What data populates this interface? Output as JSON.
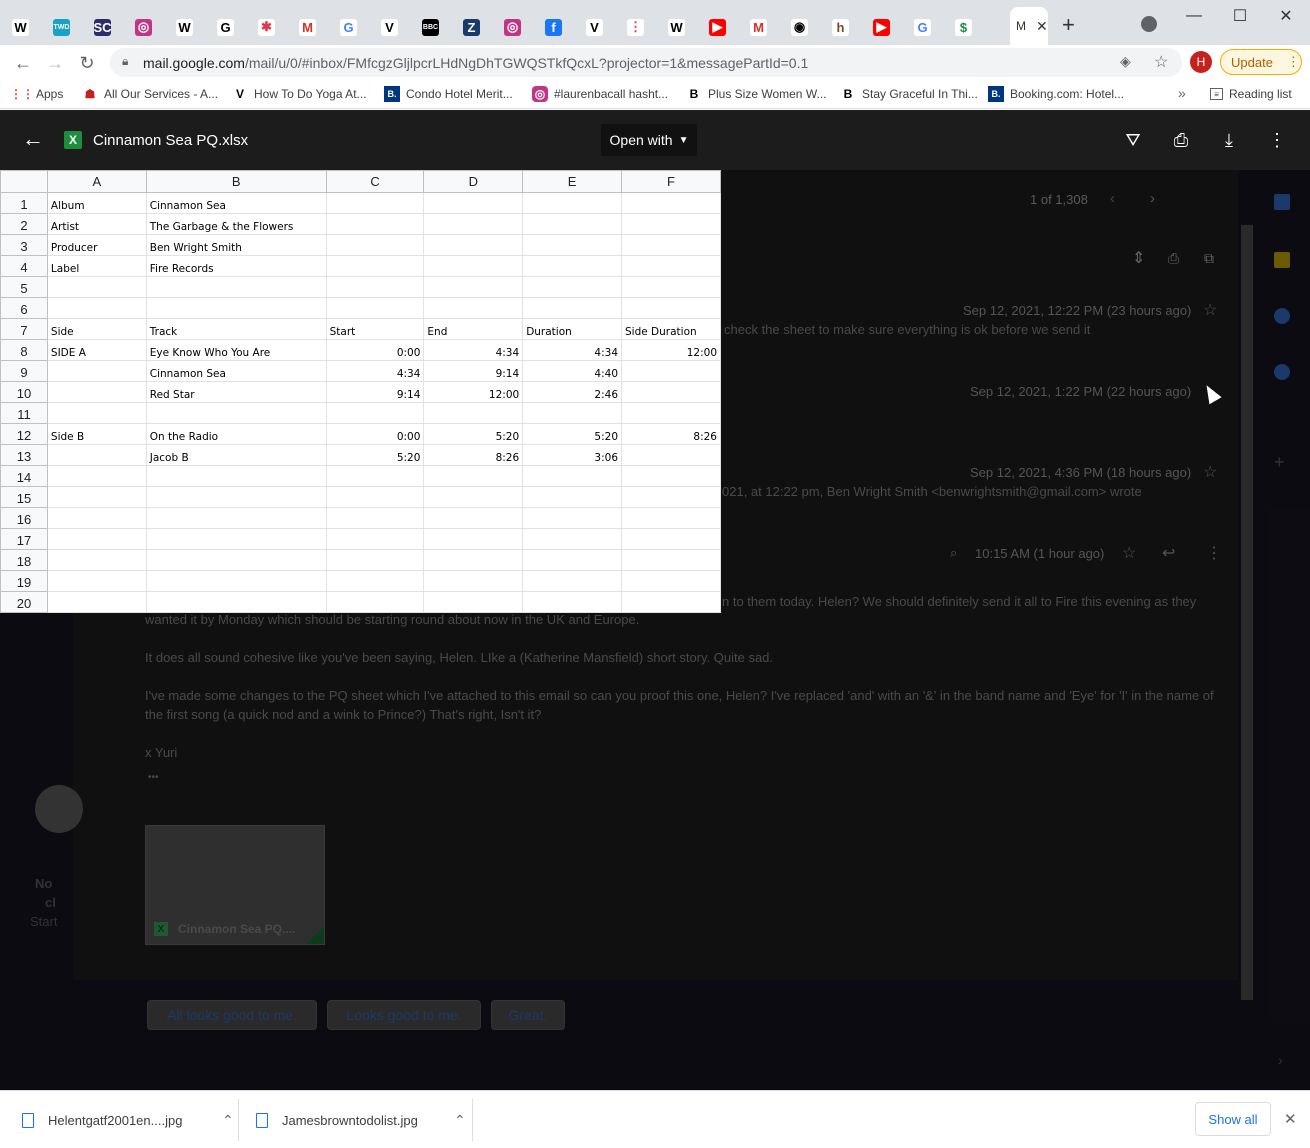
{
  "browser": {
    "tabs": [
      {
        "icon": "wikipedia-icon",
        "glyph": "W",
        "color": "#ffffff",
        "fg": "#000000"
      },
      {
        "icon": "twd-icon",
        "glyph": "TWD",
        "color": "#17a2c8",
        "fg": "#ffffff"
      },
      {
        "icon": "sc-icon",
        "glyph": "SC",
        "color": "#2c2c6c",
        "fg": "#ffffff"
      },
      {
        "icon": "instagram-icon",
        "glyph": "◎",
        "color": "#c13584",
        "fg": "#ffffff"
      },
      {
        "icon": "wikipedia-icon",
        "glyph": "W",
        "color": "#ffffff",
        "fg": "#000000"
      },
      {
        "icon": "genius-icon",
        "glyph": "G",
        "color": "#ffffff",
        "fg": "#000000"
      },
      {
        "icon": "asterisk-icon",
        "glyph": "✱",
        "color": "#ffffff",
        "fg": "#e23744"
      },
      {
        "icon": "gmail-icon",
        "glyph": "M",
        "color": "#ffffff",
        "fg": "#d93025"
      },
      {
        "icon": "google-icon",
        "glyph": "G",
        "color": "#ffffff",
        "fg": "#4285f4"
      },
      {
        "icon": "vogue-icon",
        "glyph": "V",
        "color": "#ffffff",
        "fg": "#000000"
      },
      {
        "icon": "bbc-icon",
        "glyph": "BBC",
        "color": "#000000",
        "fg": "#ffffff"
      },
      {
        "icon": "z-icon",
        "glyph": "Z",
        "color": "#1a3a6a",
        "fg": "#ffffff"
      },
      {
        "icon": "instagram-icon",
        "glyph": "◎",
        "color": "#c13584",
        "fg": "#ffffff"
      },
      {
        "icon": "facebook-icon",
        "glyph": "f",
        "color": "#1877f2",
        "fg": "#ffffff"
      },
      {
        "icon": "vogue-icon",
        "glyph": "V",
        "color": "#ffffff",
        "fg": "#000000"
      },
      {
        "icon": "dots-icon",
        "glyph": "⋮",
        "color": "#ffffff",
        "fg": "#e23744"
      },
      {
        "icon": "wikipedia-icon",
        "glyph": "W",
        "color": "#ffffff",
        "fg": "#000000"
      },
      {
        "icon": "youtube-icon",
        "glyph": "▶",
        "color": "#ff0000",
        "fg": "#ffffff"
      },
      {
        "icon": "gmail-icon",
        "glyph": "M",
        "color": "#ffffff",
        "fg": "#d93025"
      },
      {
        "icon": "abc-icon",
        "glyph": "◉",
        "color": "#ffffff",
        "fg": "#000000"
      },
      {
        "icon": "houzz-icon",
        "glyph": "h",
        "color": "#ffffff",
        "fg": "#7a4a2a"
      },
      {
        "icon": "youtube-icon",
        "glyph": "▶",
        "color": "#ff0000",
        "fg": "#ffffff"
      },
      {
        "icon": "google-icon",
        "glyph": "G",
        "color": "#ffffff",
        "fg": "#4285f4"
      },
      {
        "icon": "docs-icon",
        "glyph": "$",
        "color": "#ffffff",
        "fg": "#1e8e3e"
      }
    ],
    "active_tab_label": "M",
    "url_host": "mail.google.com",
    "url_rest": "/mail/u/0/#inbox/FMfcgzGljlpcrLHdNgDhTGWQSTkfQcxL?projector=1&messagePartId=0.1",
    "profile_initial": "H",
    "update_label": "Update",
    "bookmarks": [
      {
        "label": "Apps",
        "icon": "apps-grid-icon"
      },
      {
        "label": "All Our Services - A...",
        "icon": "service-icon"
      },
      {
        "label": "How To Do Yoga At...",
        "icon": "vogue-icon"
      },
      {
        "label": "Condo Hotel Merit...",
        "icon": "booking-icon"
      },
      {
        "label": "#laurenbacall hasht...",
        "icon": "instagram-icon"
      },
      {
        "label": "Plus Size Women W...",
        "icon": "b-icon"
      },
      {
        "label": "Stay Graceful In Thi...",
        "icon": "b-icon"
      },
      {
        "label": "Booking.com: Hotel...",
        "icon": "booking-icon"
      }
    ],
    "reading_list": "Reading list"
  },
  "viewer": {
    "file_name": "Cinnamon Sea PQ.xlsx",
    "file_badge": "X",
    "open_with": "Open with"
  },
  "sheet": {
    "columns": [
      "A",
      "B",
      "C",
      "D",
      "E",
      "F"
    ],
    "rows": [
      [
        "1",
        "Album",
        "Cinnamon Sea",
        "",
        "",
        "",
        ""
      ],
      [
        "2",
        "Artist",
        "The Garbage & the Flowers",
        "",
        "",
        "",
        ""
      ],
      [
        "3",
        "Producer",
        "Ben Wright Smith",
        "",
        "",
        "",
        ""
      ],
      [
        "4",
        "Label",
        "Fire Records",
        "",
        "",
        "",
        ""
      ],
      [
        "5",
        "",
        "",
        "",
        "",
        "",
        ""
      ],
      [
        "6",
        "",
        "",
        "",
        "",
        "",
        ""
      ],
      [
        "7",
        "Side",
        "Track",
        "Start",
        "End",
        "Duration",
        "Side Duration"
      ],
      [
        "8",
        "SIDE A",
        "Eye Know Who You Are",
        "0:00",
        "4:34",
        "4:34",
        "12:00"
      ],
      [
        "9",
        "",
        "Cinnamon Sea",
        "4:34",
        "9:14",
        "4:40",
        ""
      ],
      [
        "10",
        "",
        "Red Star",
        "9:14",
        "12:00",
        "2:46",
        ""
      ],
      [
        "11",
        "",
        "",
        "",
        "",
        "",
        ""
      ],
      [
        "12",
        "Side B",
        "On the Radio",
        "0:00",
        "5:20",
        "5:20",
        "8:26"
      ],
      [
        "13",
        "",
        "Jacob B",
        "5:20",
        "8:26",
        "3:06",
        ""
      ],
      [
        "14",
        "",
        "",
        "",
        "",
        "",
        ""
      ],
      [
        "15",
        "",
        "",
        "",
        "",
        "",
        ""
      ],
      [
        "16",
        "",
        "",
        "",
        "",
        "",
        ""
      ],
      [
        "17",
        "",
        "",
        "",
        "",
        "",
        ""
      ],
      [
        "18",
        "",
        "",
        "",
        "",
        "",
        ""
      ],
      [
        "19",
        "",
        "",
        "",
        "",
        "",
        ""
      ],
      [
        "20",
        "",
        "",
        "",
        "",
        "",
        ""
      ]
    ]
  },
  "email": {
    "count": "1 of 1,308",
    "msg1_time": "Sep 12, 2021, 12:22 PM (23 hours ago)",
    "msg1_snippet": "check the sheet to make sure everything is ok before we send it",
    "msg2_time": "Sep 12, 2021, 1:22 PM (22 hours ago)",
    "msg3_time": "Sep 12, 2021, 4:36 PM (18 hours ago)",
    "msg3_snippet": "021, at 12:22 pm, Ben Wright Smith <benwrightsmith@gmail.com> wrote",
    "msg4_time": "10:15 AM (1 hour ago)",
    "body_line1": "n to them today. Helen? We should definitely send it all to Fire this evening as they",
    "body_line2": "wanted it by Monday which should be starting round about now in the UK and Europe.",
    "body_line3": "It does all sound cohesive like you've been saying, Helen. LIke a (Katherine Mansfield) short story. Quite sad.",
    "body_line4": "I've made some changes to the PQ sheet which I've attached to this email so can you proof this one, Helen? I've replaced 'and' with an '&' in the band name and 'Eye' for 'I' in the name of",
    "body_line5": "the first song (a quick nod and a wink to Prince?) That's right, Isn't it?",
    "signoff": "x Yuri",
    "ellipsis": "•••",
    "attachment_name": "Cinnamon Sea PQ....",
    "side_text1": "No",
    "side_text2": "cl",
    "side_text3": "Start",
    "suggestions": [
      "All looks good to me.",
      "Looks good to me.",
      "Great."
    ]
  },
  "downloads": {
    "items": [
      "Helentgatf2001en....jpg",
      "Jamesbrowntodolist.jpg"
    ],
    "show_all": "Show all"
  }
}
